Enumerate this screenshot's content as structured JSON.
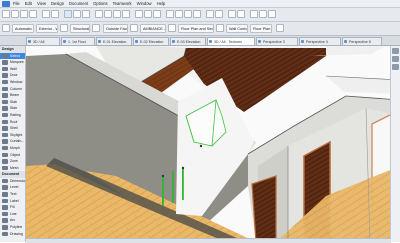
{
  "menubar": {
    "items": [
      "File",
      "Edit",
      "View",
      "Design",
      "Document",
      "Options",
      "Teamwork",
      "Window",
      "Help"
    ]
  },
  "toolbar": {
    "floor_field": "Automatic Floor",
    "wall_field": "Exterior - Wood",
    "geometry_label": "Structural",
    "location_label": "Outside Face",
    "layer_field": "AMBIANCE - Wall",
    "plan_label": "Floor Plan and Section...",
    "height_label": "Wall Contours",
    "floor_plan_label": "Floor Plan"
  },
  "tabs": [
    {
      "label": "3D / All"
    },
    {
      "label": "1. 1st Floor"
    },
    {
      "label": "E-01 Elevation"
    },
    {
      "label": "E-02 Elevation"
    },
    {
      "label": "E-03 Elevation"
    },
    {
      "label": "3D / All - Textures"
    },
    {
      "label": "Perspective 3"
    },
    {
      "label": "Perspective 4"
    },
    {
      "label": "Perspective 5"
    }
  ],
  "toolbox": {
    "items": [
      {
        "label": "Design",
        "header": true
      },
      {
        "label": "Select",
        "selected": true
      },
      {
        "label": "Marquee"
      },
      {
        "label": "Wall"
      },
      {
        "label": "Door"
      },
      {
        "label": "Window"
      },
      {
        "label": "Column"
      },
      {
        "label": "Beam"
      },
      {
        "label": "Slab"
      },
      {
        "label": "Stair"
      },
      {
        "label": "Railing"
      },
      {
        "label": "Roof"
      },
      {
        "label": "Shell"
      },
      {
        "label": "Skylight"
      },
      {
        "label": "Curtain..."
      },
      {
        "label": "Morph"
      },
      {
        "label": "Object"
      },
      {
        "label": "Zone"
      },
      {
        "label": "Mesh"
      },
      {
        "label": "Document",
        "header": true
      },
      {
        "label": "Dimension"
      },
      {
        "label": "Level"
      },
      {
        "label": "Text"
      },
      {
        "label": "Label"
      },
      {
        "label": "Fill"
      },
      {
        "label": "Line"
      },
      {
        "label": "Arc"
      },
      {
        "label": "Polyline"
      },
      {
        "label": "Drawing"
      }
    ]
  },
  "colors": {
    "accent": "#3f86e0",
    "wall_grey": "#8e8e86",
    "floor_wood": "#e8b567",
    "dark_wood": "#5a2a14",
    "selection_green": "#3fc33f"
  }
}
